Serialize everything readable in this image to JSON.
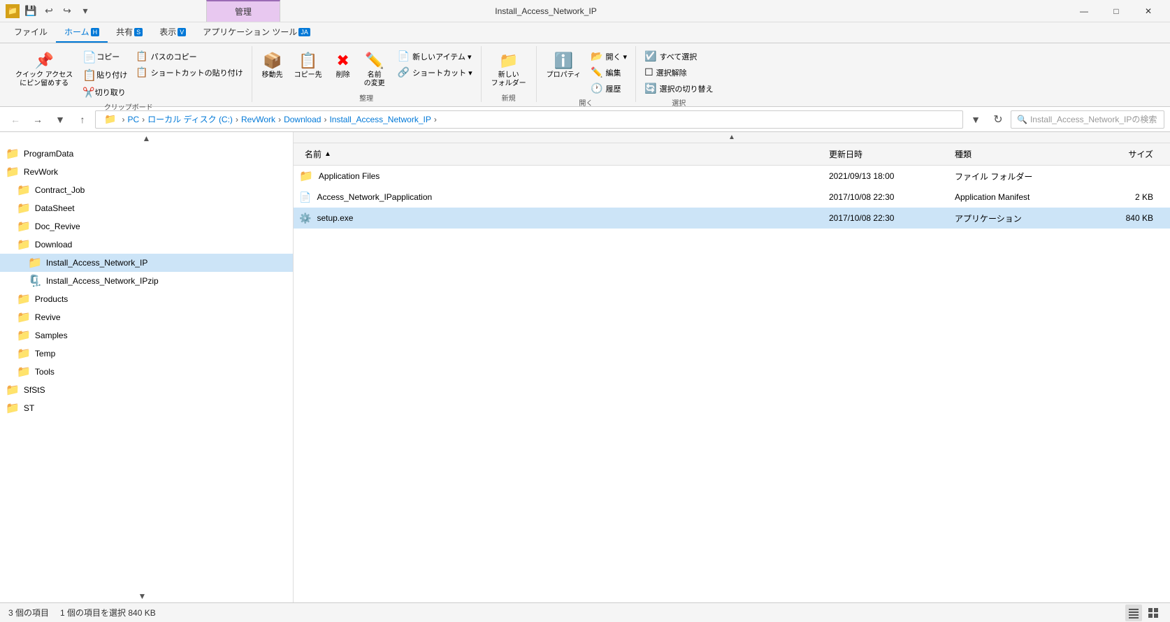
{
  "titleBar": {
    "title": "Install_Access_Network_IP",
    "managementTab": "管理",
    "appToolsTab": "アプリケーション ツール",
    "homeTab": "ホーム",
    "shareTab": "共有",
    "viewTab": "表示",
    "shortcutH": "H",
    "shortcutS": "S",
    "shortcutV": "V",
    "shortcutJA": "JA",
    "fileTab": "ファイル",
    "windowControls": {
      "minimize": "—",
      "maximize": "□",
      "close": "✕"
    }
  },
  "ribbon": {
    "clipboardGroup": "クリップボード",
    "organizeGroup": "整理",
    "newGroup": "新規",
    "openGroup": "開く",
    "selectGroup": "選択",
    "pinQuickAccess": "クイック アクセス\nにピン留めする",
    "copy": "コピー",
    "paste": "貼り付け",
    "cut": "切り取り",
    "copyPath": "パスのコピー",
    "pasteShortcut": "ショートカットの貼り付け",
    "moveTo": "移動先",
    "copyTo": "コピー先",
    "delete": "削除",
    "rename": "名前\nの変更",
    "newFolder": "新しい\nフォルダー",
    "newItem": "新しいアイテム ▾",
    "shortcut": "ショートカット ▾",
    "properties": "プロパティ",
    "open": "開く ▾",
    "edit": "編集",
    "history": "履歴",
    "selectAll": "すべて選択",
    "selectNone": "選択解除",
    "invertSelection": "選択の切り替え"
  },
  "addressBar": {
    "breadcrumb": [
      "PC",
      "ローカル ディスク (C:)",
      "RevWork",
      "Download",
      "Install_Access_Network_IP"
    ],
    "searchPlaceholder": "Install_Access_Network_IPの検索"
  },
  "sidebar": {
    "items": [
      {
        "label": "ProgramData",
        "indent": 0,
        "selected": false
      },
      {
        "label": "RevWork",
        "indent": 0,
        "selected": false
      },
      {
        "label": "Contract_Job",
        "indent": 1,
        "selected": false
      },
      {
        "label": "DataSheet",
        "indent": 1,
        "selected": false
      },
      {
        "label": "Doc_Revive",
        "indent": 1,
        "selected": false
      },
      {
        "label": "Download",
        "indent": 1,
        "selected": false
      },
      {
        "label": "Install_Access_Network_IP",
        "indent": 2,
        "selected": true
      },
      {
        "label": "Install_Access_Network_IPzip",
        "indent": 2,
        "selected": false
      },
      {
        "label": "Products",
        "indent": 1,
        "selected": false
      },
      {
        "label": "Revive",
        "indent": 1,
        "selected": false
      },
      {
        "label": "Samples",
        "indent": 1,
        "selected": false
      },
      {
        "label": "Temp",
        "indent": 1,
        "selected": false
      },
      {
        "label": "Tools",
        "indent": 1,
        "selected": false
      },
      {
        "label": "SfStS",
        "indent": 0,
        "selected": false
      },
      {
        "label": "ST",
        "indent": 0,
        "selected": false
      }
    ]
  },
  "fileList": {
    "columns": {
      "name": "名前",
      "date": "更新日時",
      "type": "種類",
      "size": "サイズ"
    },
    "files": [
      {
        "name": "Application Files",
        "date": "2021/09/13 18:00",
        "type": "ファイル フォルダー",
        "size": "",
        "icon": "folder",
        "selected": false
      },
      {
        "name": "Access_Network_IPapplication",
        "date": "2017/10/08 22:30",
        "type": "Application Manifest",
        "size": "2 KB",
        "icon": "manifest",
        "selected": false
      },
      {
        "name": "setup.exe",
        "date": "2017/10/08 22:30",
        "type": "アプリケーション",
        "size": "840 KB",
        "icon": "exe",
        "selected": true
      }
    ]
  },
  "statusBar": {
    "itemCount": "3 個の項目",
    "selectedInfo": "1 個の項目を選択  840 KB"
  }
}
